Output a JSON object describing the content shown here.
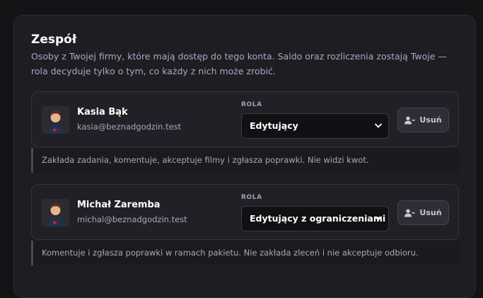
{
  "team": {
    "title": "Zespół",
    "description": "Osoby z Twojej firmy, które mają dostęp do tego konta. Saldo oraz rozliczenia zostają Twoje — rola decyduje tylko o tym, co każdy z nich może zrobić."
  },
  "role_label": "ROLA",
  "remove_label": "Usuń",
  "members": [
    {
      "name": "Kasia Bąk",
      "email": "kasia@beznadgodzin.test",
      "role": "Edytujący",
      "note": "Zakłada zadania, komentuje, akceptuje filmy i zgłasza poprawki. Nie widzi kwot."
    },
    {
      "name": "Michał Zaremba",
      "email": "michal@beznadgodzin.test",
      "role": "Edytujący z ograniczeniami",
      "note": "Komentuje i zgłasza poprawki w ramach pakietu. Nie zakłada zleceń i nie akceptuje odbioru."
    }
  ],
  "colors": {
    "background": "#141417",
    "panel": "#1d1d22",
    "accent_red": "#d8232a"
  },
  "icons": [
    "person-avatar-icon",
    "chevron-down-icon",
    "user-minus-icon"
  ]
}
